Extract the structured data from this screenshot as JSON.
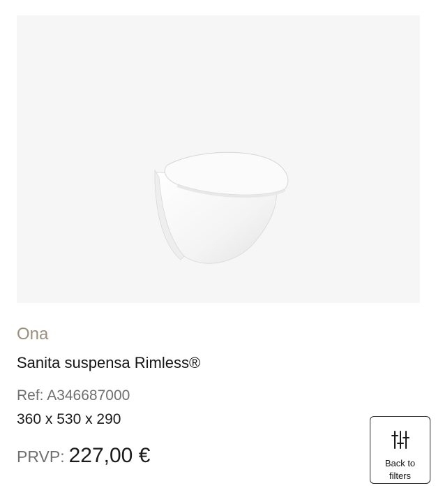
{
  "product": {
    "image_alt": "Ona wall-hung toilet",
    "brand": "Ona",
    "title": "Sanita suspensa Rimless®",
    "ref": "Ref: A346687000",
    "dimensions": "360 x 530 x 290",
    "price_label": "PRVP:",
    "price_value": "227,00 €"
  },
  "back_button": {
    "label": "Back to filters",
    "icon": "sliders-icon"
  },
  "colors": {
    "image_background": "#f6f6f6",
    "brand": "#9a8e7d",
    "muted_text": "#6f6f6f",
    "text": "#151515",
    "button_border": "#2b2b2b"
  }
}
